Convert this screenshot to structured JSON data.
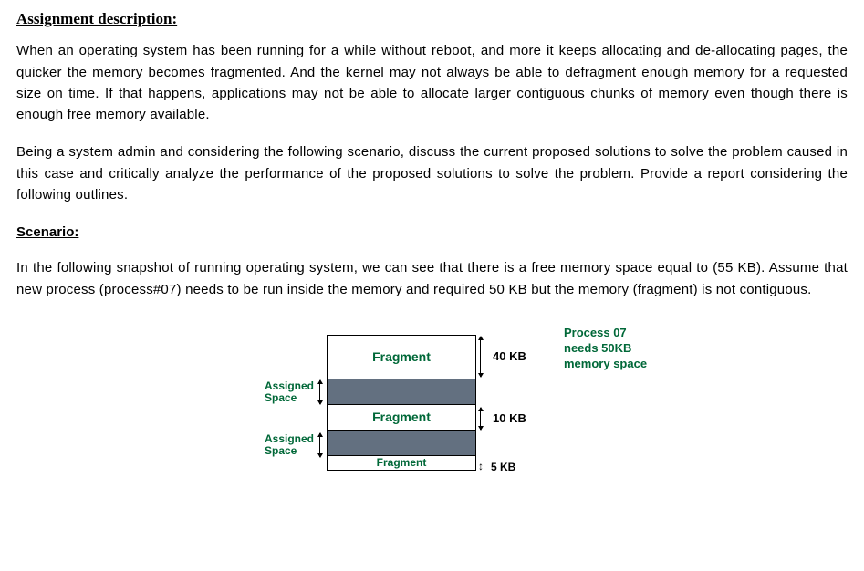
{
  "headings": {
    "assignment": "Assignment description:",
    "scenario": "Scenario:"
  },
  "paragraphs": {
    "p1": "When an operating system has been running for a while without reboot, and more it keeps allocating and de-allocating pages, the quicker the memory becomes fragmented. And the kernel may not always be able to defragment enough memory for a requested size on time. If that happens, applications may not be able to allocate larger contiguous chunks of memory even though there is enough free memory available.",
    "p2": "Being a system admin and considering the following scenario, discuss the current proposed solutions to solve the problem caused in this case and critically analyze the performance of the proposed solutions to solve the problem. Provide a report considering the following outlines.",
    "p3": "In the following snapshot of running operating system, we can see that there is a free memory space equal to (55 KB). Assume that new process (process#07) needs to be run inside the memory and required 50 KB but the memory (fragment) is not contiguous."
  },
  "diagram": {
    "row_fragment": "Fragment",
    "assigned_label": "Assigned\nSpace",
    "size1": "40 KB",
    "size2": "10 KB",
    "size3": "5 KB",
    "process_label": "Process 07\nneeds 50KB\nmemory space"
  },
  "chart_data": {
    "type": "table",
    "title": "Memory snapshot",
    "rows": [
      {
        "region": "Fragment",
        "size_kb": 40,
        "status": "free"
      },
      {
        "region": "Assigned Space",
        "size_kb": null,
        "status": "used"
      },
      {
        "region": "Fragment",
        "size_kb": 10,
        "status": "free"
      },
      {
        "region": "Assigned Space",
        "size_kb": null,
        "status": "used"
      },
      {
        "region": "Fragment",
        "size_kb": 5,
        "status": "free"
      }
    ],
    "total_free_kb": 55,
    "process": {
      "name": "Process 07",
      "required_kb": 50
    }
  }
}
